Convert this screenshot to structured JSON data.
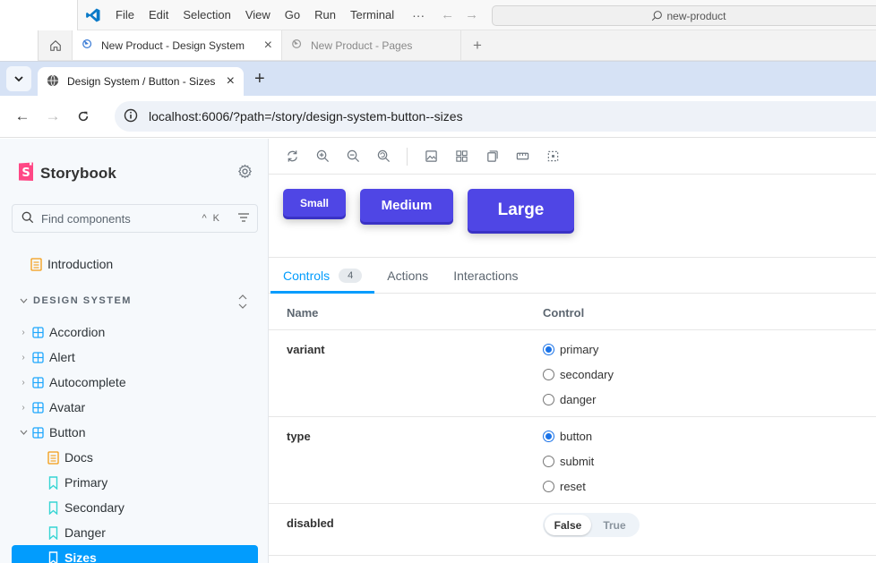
{
  "vscode": {
    "menus": [
      "File",
      "Edit",
      "Selection",
      "View",
      "Go",
      "Run",
      "Terminal"
    ],
    "more": "···",
    "search": "new-product",
    "tabs": [
      {
        "label": "New Product - Design System"
      },
      {
        "label": "New Product - Pages"
      }
    ]
  },
  "browser": {
    "tab_title": "Design System / Button - Sizes",
    "url": "localhost:6006/?path=/story/design-system-button--sizes"
  },
  "storybook": {
    "brand": "Storybook",
    "search_placeholder": "Find components",
    "search_shortcut": "^ K",
    "introduction": "Introduction",
    "section": "DESIGN SYSTEM",
    "components": [
      "Accordion",
      "Alert",
      "Autocomplete",
      "Avatar",
      "Button"
    ],
    "button_children": [
      "Docs",
      "Primary",
      "Secondary",
      "Danger",
      "Sizes"
    ]
  },
  "canvas": {
    "buttons": [
      "Small",
      "Medium",
      "Large"
    ],
    "accent": "#4f46e5"
  },
  "addons": {
    "tabs": [
      "Controls",
      "Actions",
      "Interactions"
    ],
    "controls_count": "4"
  },
  "controls": {
    "header": {
      "name": "Name",
      "control": "Control"
    },
    "variant": {
      "name": "variant",
      "options": [
        "primary",
        "secondary",
        "danger"
      ],
      "selected": "primary"
    },
    "type": {
      "name": "type",
      "options": [
        "button",
        "submit",
        "reset"
      ],
      "selected": "button"
    },
    "disabled": {
      "name": "disabled",
      "false_label": "False",
      "true_label": "True",
      "value": false
    }
  },
  "colors": {
    "storybook_blue": "#029cfd",
    "storybook_pink": "#ff4785"
  }
}
